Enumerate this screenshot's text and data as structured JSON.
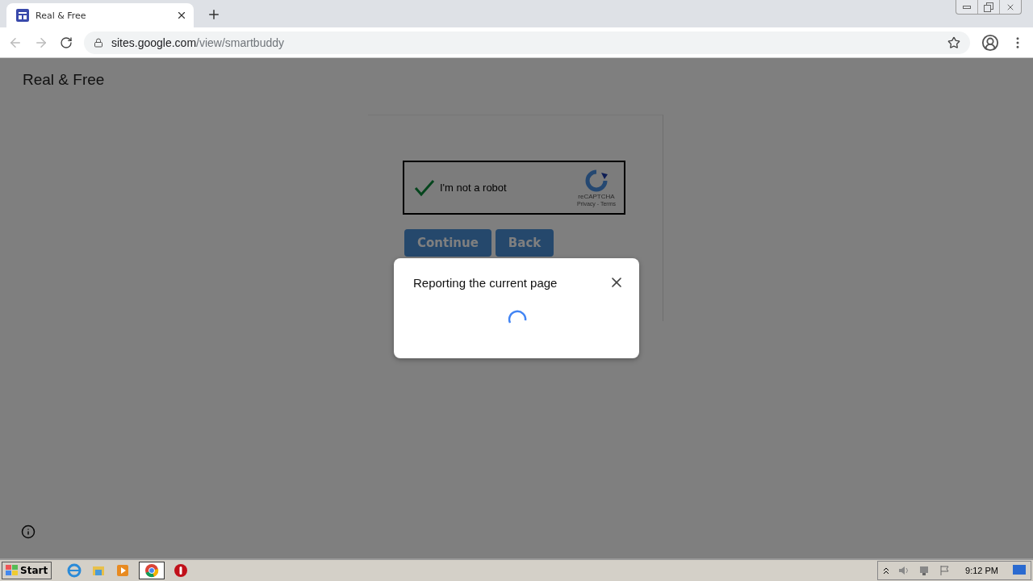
{
  "tab": {
    "title": "Real & Free",
    "selected": true
  },
  "address_bar": {
    "host": "sites.google.com",
    "path": "/view/smartbuddy"
  },
  "page": {
    "site_title": "Real & Free",
    "captcha": {
      "label": "I'm not a robot",
      "checked": true,
      "brand": "reCAPTCHA",
      "links": "Privacy - Terms"
    },
    "buttons": [
      "Continue",
      "Back"
    ]
  },
  "dialog": {
    "title": "Reporting the current page",
    "loading": true
  },
  "taskbar": {
    "start": "Start",
    "clock": "9:12 PM"
  }
}
